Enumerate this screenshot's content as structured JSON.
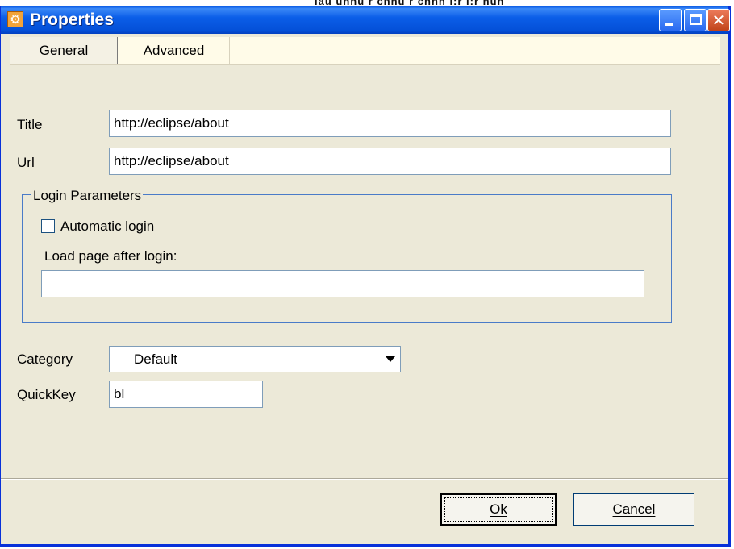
{
  "background_strip_text": "ıau unnu r cnnu r cnnn i:r i:r nun",
  "window": {
    "title": "Properties",
    "app_icon": "gear-icon",
    "controls": {
      "minimize": "minimize-icon",
      "maximize": "maximize-icon",
      "close": "close-icon",
      "close_glyph": "✕"
    }
  },
  "tabs": [
    {
      "label": "General",
      "selected": true
    },
    {
      "label": "Advanced",
      "selected": false
    }
  ],
  "form": {
    "title_label": "Title",
    "title_value": "http://eclipse/about",
    "url_label": "Url",
    "url_value": "http://eclipse/about",
    "login_group": {
      "legend": "Login Parameters",
      "automatic_login_label": "Automatic login",
      "automatic_login_checked": false,
      "load_page_label": "Load page after login:",
      "load_page_value": ""
    },
    "category_label": "Category",
    "category_value": "Default",
    "quickkey_label": "QuickKey",
    "quickkey_value": "bl"
  },
  "buttons": {
    "ok": "Ok",
    "cancel": "Cancel"
  },
  "colors": {
    "titlebar": "#0b5ee8",
    "dialog_bg": "#ece9d8",
    "group_border": "#4a7bc8",
    "close_button": "#c1441a"
  }
}
